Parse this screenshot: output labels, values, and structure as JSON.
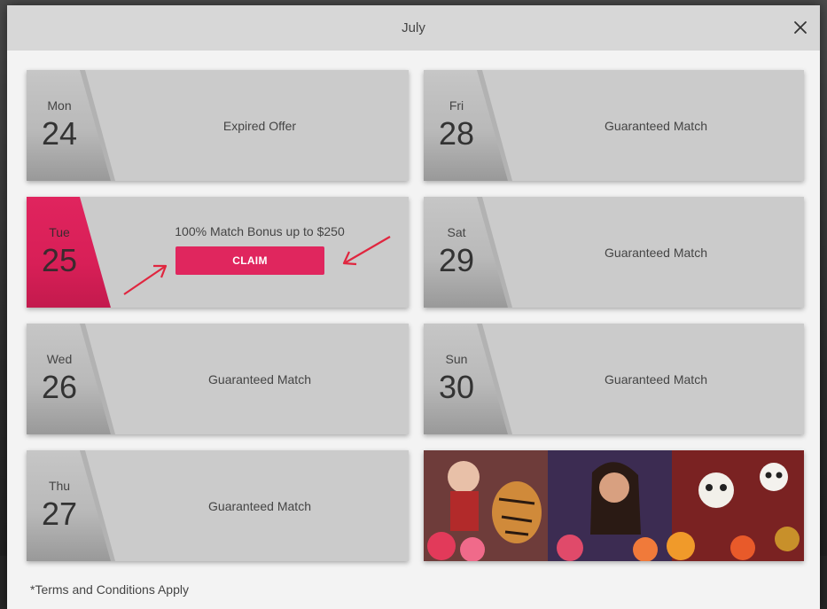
{
  "modal": {
    "title": "July",
    "close_icon": "close-icon"
  },
  "days": [
    {
      "dow": "Mon",
      "num": "24",
      "label": "Expired Offer"
    },
    {
      "dow": "Tue",
      "num": "25",
      "label": "100% Match Bonus up to $250",
      "button": "CLAIM",
      "active": true
    },
    {
      "dow": "Wed",
      "num": "26",
      "label": "Guaranteed Match"
    },
    {
      "dow": "Thu",
      "num": "27",
      "label": "Guaranteed Match"
    },
    {
      "dow": "Fri",
      "num": "28",
      "label": "Guaranteed Match"
    },
    {
      "dow": "Sat",
      "num": "29",
      "label": "Guaranteed Match"
    },
    {
      "dow": "Sun",
      "num": "30",
      "label": "Guaranteed Match"
    }
  ],
  "terms": "*Terms and Conditions Apply",
  "colors": {
    "accent": "#e0265e",
    "card_bg": "#cbcbcb",
    "header_bg": "#d7d7d7",
    "annotation_arrow": "#e0263f"
  }
}
